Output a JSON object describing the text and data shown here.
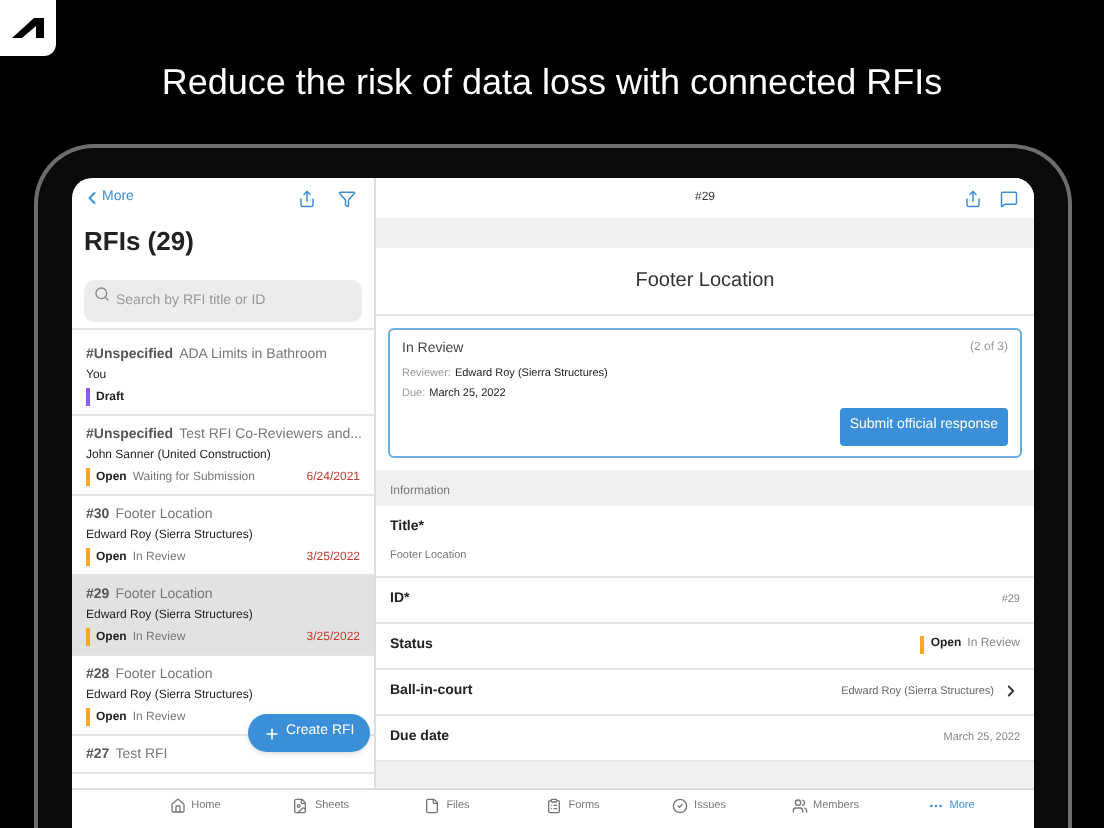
{
  "headline": "Reduce the risk of data loss with connected RFIs",
  "list_pane": {
    "back": "More",
    "title": "RFIs (29)",
    "search": {
      "placeholder": "Search by RFI title or ID"
    },
    "items": [
      {
        "number": "#Unspecified",
        "title": "ADA Limits in Bathroom",
        "author": "You",
        "status": "Draft",
        "color": "#8b5cf6",
        "selected": false
      },
      {
        "number": "#Unspecified",
        "title": "Test RFI Co-Reviewers and...",
        "author": "John Sanner (United Construction)",
        "status": "Open",
        "substatus": "Waiting for Submission",
        "date": "6/24/2021",
        "color": "#f5a623",
        "selected": false
      },
      {
        "number": "#30",
        "title": "Footer Location",
        "author": "Edward Roy (Sierra Structures)",
        "status": "Open",
        "substatus": "In Review",
        "date": "3/25/2022",
        "color": "#f5a623",
        "selected": false
      },
      {
        "number": "#29",
        "title": "Footer Location",
        "author": "Edward Roy (Sierra Structures)",
        "status": "Open",
        "substatus": "In Review",
        "date": "3/25/2022",
        "color": "#f5a623",
        "selected": true
      },
      {
        "number": "#28",
        "title": "Footer Location",
        "author": "Edward Roy (Sierra Structures)",
        "status": "Open",
        "substatus": "In Review",
        "color": "#f5a623",
        "selected": false
      },
      {
        "number": "#27",
        "title": "Test RFI",
        "selected": false
      }
    ],
    "create_button": "Create RFI"
  },
  "detail": {
    "number": "#29",
    "title": "Footer Location",
    "review_card": {
      "status": "In Review",
      "step": "(2 of 3)",
      "reviewer_label": "Reviewer:",
      "reviewer": "Edward Roy (Sierra Structures)",
      "due_label": "Due:",
      "due": "March 25, 2022",
      "button": "Submit official response"
    },
    "section": "Information",
    "fields": [
      {
        "kind": "stacked",
        "label": "Title*",
        "value": "Footer Location"
      },
      {
        "kind": "plain",
        "label": "ID*",
        "value": "#29"
      },
      {
        "kind": "status",
        "label": "Status",
        "status": "Open",
        "substatus": "In Review",
        "color": "#f5a623"
      },
      {
        "kind": "link",
        "label": "Ball-in-court",
        "value": "Edward Roy (Sierra Structures)"
      },
      {
        "kind": "plain",
        "label": "Due date",
        "value": "March 25, 2022"
      }
    ]
  },
  "tabs": [
    {
      "label": "Home",
      "selected": false
    },
    {
      "label": "Sheets",
      "selected": false
    },
    {
      "label": "Files",
      "selected": false
    },
    {
      "label": "Forms",
      "selected": false
    },
    {
      "label": "Issues",
      "selected": false
    },
    {
      "label": "Members",
      "selected": false
    },
    {
      "label": "More",
      "selected": true
    }
  ]
}
